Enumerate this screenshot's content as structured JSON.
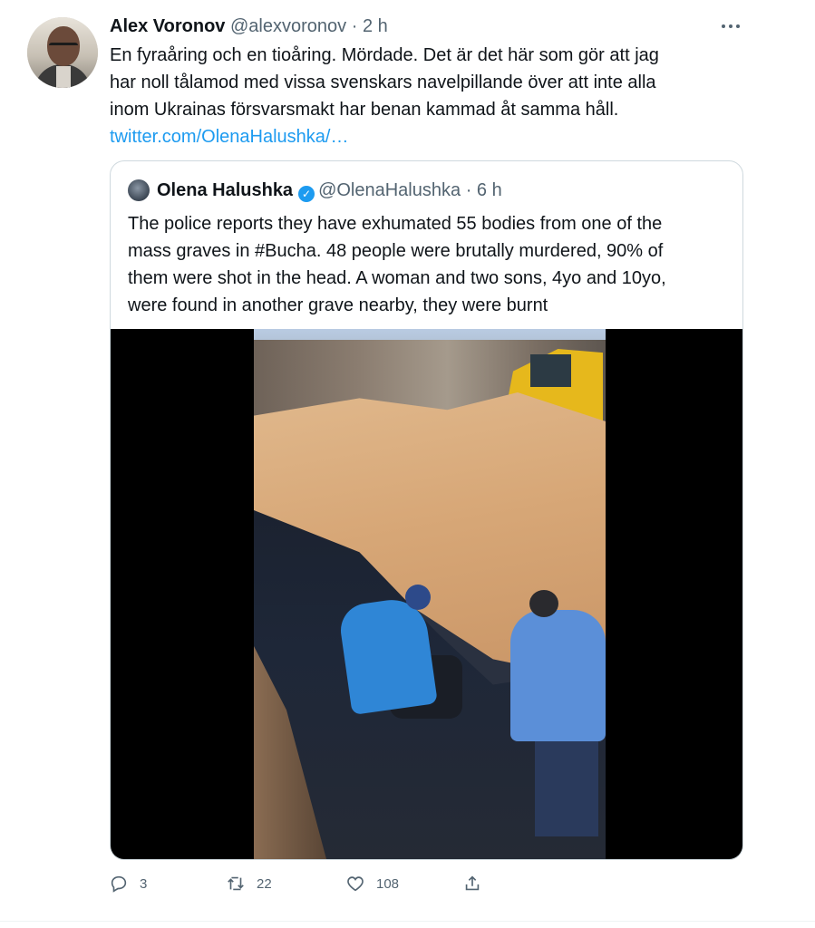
{
  "tweet": {
    "author_name": "Alex Voronov",
    "author_handle": "@alexvoronov",
    "separator": "·",
    "time": "2 h",
    "text_lines": [
      "En fyraåring och en tioåring. Mördade. Det är det här som gör att jag",
      "har noll tålamod med vissa svenskars navelpillande över att inte alla",
      "inom Ukrainas försvarsmakt har benan kammad åt samma håll."
    ],
    "link_text": "twitter.com/OlenaHalushka/…"
  },
  "quoted": {
    "author_name": "Olena Halushka",
    "verified_mark": "✓",
    "author_handle": "@OlenaHalushka",
    "separator": "·",
    "time": "6 h",
    "text_lines": [
      "The police reports they have exhumated 55 bodies from one of the",
      "mass graves in #Bucha. 48 people were brutally murdered, 90% of",
      "them were shot in the head. A woman and two sons, 4yo and 10yo,",
      "were found in another grave nearby, they were burnt"
    ]
  },
  "actions": {
    "reply_count": "3",
    "retweet_count": "22",
    "like_count": "108"
  },
  "icons": [
    "more-icon",
    "verified-icon",
    "reply-icon",
    "retweet-icon",
    "like-icon",
    "share-icon"
  ],
  "colors": {
    "link": "#1d9bf0",
    "secondary_text": "#536471",
    "border": "#cfd9de"
  }
}
